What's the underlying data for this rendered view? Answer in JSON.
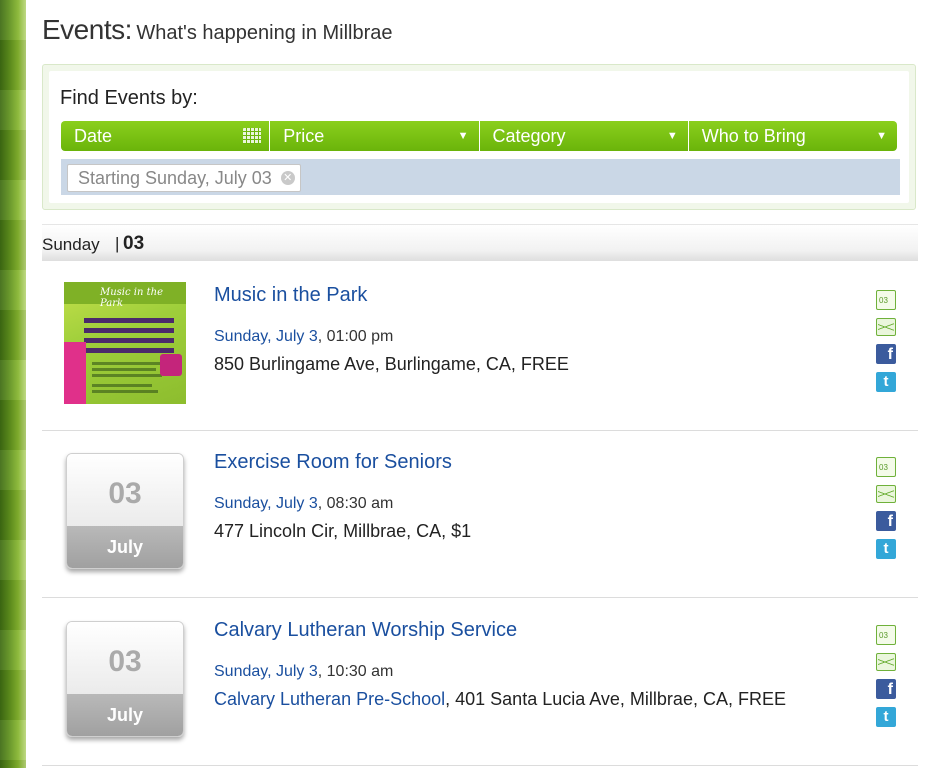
{
  "header": {
    "title": "Events:",
    "subtitle": "What's happening in Millbrae"
  },
  "filters": {
    "label": "Find Events by:",
    "tabs": [
      {
        "label": "Date",
        "icon": "calendar-icon"
      },
      {
        "label": "Price",
        "icon": "caret-down-icon"
      },
      {
        "label": "Category",
        "icon": "caret-down-icon"
      },
      {
        "label": "Who to Bring",
        "icon": "caret-down-icon"
      }
    ],
    "active_chip": "Starting Sunday, July 03"
  },
  "day": {
    "name": "Sunday",
    "separator": "|",
    "number": "03"
  },
  "events": [
    {
      "title": "Music in the Park",
      "date_link": "Sunday, July 3",
      "time": ", 01:00 pm",
      "location_link": "",
      "location": "850 Burlingame Ave, Burlingame, CA, FREE",
      "thumbnail_title": "Music in the Park"
    },
    {
      "title": "Exercise Room for Seniors",
      "date_link": "Sunday, July 3",
      "time": ", 08:30 am",
      "location_link": "",
      "location": "477 Lincoln Cir, Millbrae, CA, $1",
      "badge_day": "03",
      "badge_month": "July"
    },
    {
      "title": "Calvary Lutheran Worship Service",
      "date_link": "Sunday, July 3",
      "time": ", 10:30 am",
      "location_link": "Calvary Lutheran Pre-School",
      "location": ", 401 Santa Lucia Ave, Millbrae, CA, FREE",
      "badge_day": "03",
      "badge_month": "July"
    }
  ],
  "share_icons": {
    "calendar_text": "03",
    "facebook": "f",
    "twitter": "t"
  },
  "colors": {
    "filter_bar": "#6ab40a",
    "link": "#1a4f9f",
    "facebook": "#3b5b9d",
    "twitter": "#33a7d8"
  }
}
